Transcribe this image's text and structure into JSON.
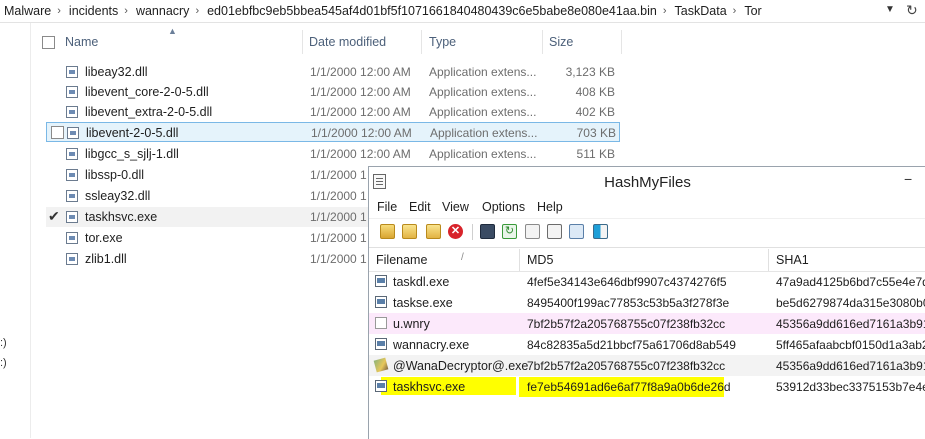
{
  "breadcrumb": {
    "items": [
      "Malware",
      "incidents",
      "wannacry",
      "ed01ebfbc9eb5bbea545af4d01bf5f1071661840480439c6e5babe8e080e41aa.bin",
      "TaskData",
      "Tor"
    ],
    "separator": "›",
    "dropdown_icon": "chevron-down-icon",
    "refresh_icon": "refresh-icon"
  },
  "left_pane": {
    "fragments": [
      ":)",
      ":)"
    ]
  },
  "explorer": {
    "columns": {
      "name": "Name",
      "date": "Date modified",
      "type": "Type",
      "size": "Size"
    },
    "files": [
      {
        "name": "libeay32.dll",
        "date": "1/1/2000 12:00 AM",
        "type": "Application extens...",
        "size": "3,123 KB"
      },
      {
        "name": "libevent_core-2-0-5.dll",
        "date": "1/1/2000 12:00 AM",
        "type": "Application extens...",
        "size": "408 KB"
      },
      {
        "name": "libevent_extra-2-0-5.dll",
        "date": "1/1/2000 12:00 AM",
        "type": "Application extens...",
        "size": "402 KB"
      },
      {
        "name": "libevent-2-0-5.dll",
        "date": "1/1/2000 12:00 AM",
        "type": "Application extens...",
        "size": "703 KB"
      },
      {
        "name": "libgcc_s_sjlj-1.dll",
        "date": "1/1/2000 12:00 AM",
        "type": "Application extens...",
        "size": "511 KB"
      },
      {
        "name": "libssp-0.dll",
        "date": "1/1/2000 1"
      },
      {
        "name": "ssleay32.dll",
        "date": "1/1/2000 1"
      },
      {
        "name": "taskhsvc.exe",
        "date": "1/1/2000 1"
      },
      {
        "name": "tor.exe",
        "date": "1/1/2000 1"
      },
      {
        "name": "zlib1.dll",
        "date": "1/1/2000 1"
      }
    ]
  },
  "hashmyfiles": {
    "title": "HashMyFiles",
    "minimize": "−",
    "menu": [
      "File",
      "Edit",
      "View",
      "Options",
      "Help"
    ],
    "columns": {
      "filename": "Filename",
      "md5": "MD5",
      "sha1": "SHA1"
    },
    "rows": [
      {
        "filename": "taskdl.exe",
        "md5": "4fef5e34143e646dbf9907c4374276f5",
        "sha1": "47a9ad4125b6bd7c55e4e7da"
      },
      {
        "filename": "taskse.exe",
        "md5": "8495400f199ac77853c53b5a3f278f3e",
        "sha1": "be5d6279874da315e3080b06"
      },
      {
        "filename": "u.wnry",
        "md5": "7bf2b57f2a205768755c07f238fb32cc",
        "sha1": "45356a9dd616ed7161a3b919"
      },
      {
        "filename": "wannacry.exe",
        "md5": "84c82835a5d21bbcf75a61706d8ab549",
        "sha1": "5ff465afaabcbf0150d1a3ab2"
      },
      {
        "filename": "@WanaDecryptor@.exe",
        "md5": "7bf2b57f2a205768755c07f238fb32cc",
        "sha1": "45356a9dd616ed7161a3b919"
      },
      {
        "filename": "taskhsvc.exe",
        "md5": "fe7eb54691ad6e6af77f8a9a0b6de26d",
        "sha1": "53912d33bec3375153b7e4e68"
      }
    ],
    "highlight_color": "#ffff00",
    "row_pink": "#fce9fb"
  }
}
